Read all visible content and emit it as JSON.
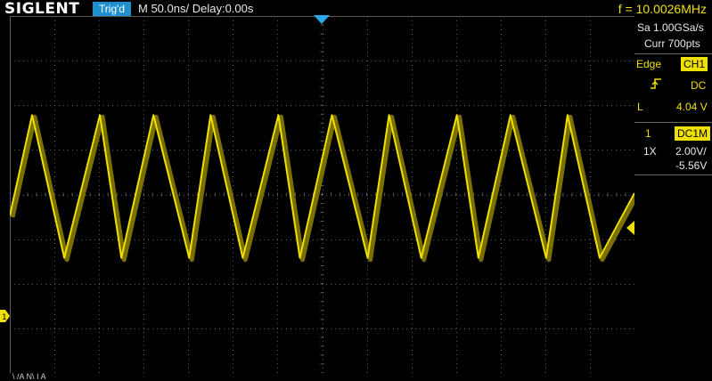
{
  "header": {
    "brand": "SIGLENT",
    "trig_status": "Trig'd",
    "timebase": "M 50.0ns/",
    "delay": "Delay:0.00s",
    "frequency": "f = 10.0026MHz"
  },
  "acquisition": {
    "sample_rate": "Sa 1.00GSa/s",
    "memory": "Curr 700pts"
  },
  "trigger": {
    "type": "Edge",
    "source": "CH1",
    "slope_icon": "rising-edge-icon",
    "coupling": "DC",
    "level_label": "L",
    "level": "4.04 V"
  },
  "channel1": {
    "number": "1",
    "coupling": "DC1M",
    "probe": "1X",
    "scale": "2.00V/",
    "offset": "-5.56V",
    "ground_marker": "1"
  },
  "footer": {
    "partial_label": "\\ /A N\\ I A"
  },
  "chart_data": {
    "type": "line",
    "title": "",
    "xlabel": "",
    "ylabel": "",
    "waveform": "triangle",
    "series": [
      {
        "color": "#f0e000",
        "x": [
          0,
          12.5,
          30.5,
          50.5,
          62.5,
          80.5,
          100.5,
          112.5,
          130.5,
          150.5,
          162.5,
          180.5,
          200.5,
          212.5,
          230.5,
          250.5,
          262.5,
          280.5,
          300.5,
          312.5,
          330.5,
          350.0
        ],
        "values": [
          -0.47,
          1.78,
          -1.42,
          1.78,
          -1.42,
          1.78,
          -1.42,
          1.78,
          -1.42,
          1.78,
          -1.42,
          1.78,
          -1.42,
          1.78,
          -1.42,
          1.78,
          -1.42,
          1.78,
          -1.42,
          1.78,
          -1.42,
          0.03
        ]
      }
    ],
    "xlim": [
      0,
      350
    ],
    "ylim": [
      -4,
      4
    ],
    "x_divisions": 14,
    "y_divisions": 8,
    "grid": true,
    "colors": {
      "trace": "#f0e000",
      "grid": "#5a5a5a",
      "trigger": "#2aa8e8"
    }
  }
}
